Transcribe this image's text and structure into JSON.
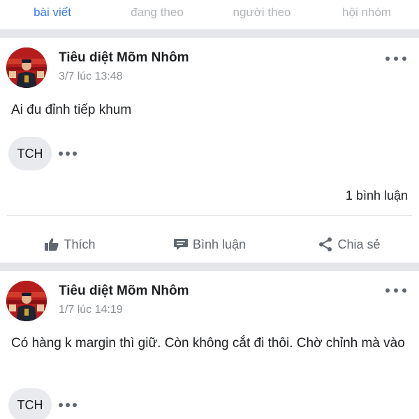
{
  "tabs": [
    {
      "label": "bài viết",
      "active": true
    },
    {
      "label": "đang theo",
      "active": false
    },
    {
      "label": "người theo",
      "active": false
    },
    {
      "label": "hội nhóm",
      "active": false
    }
  ],
  "colors": {
    "accent": "#3578e5",
    "separator": "#e4e6e9",
    "muted_text": "#8a8d91",
    "avatar_bg": "#b51d1d"
  },
  "posts": [
    {
      "author": "Tiêu diệt Mõm Nhôm",
      "time": "3/7 lúc 13:48",
      "content": "Ai đu đỉnh tiếp khum",
      "reaction_chip": "TCH",
      "comment_count": "1 bình luận",
      "actions": {
        "like": "Thích",
        "comment": "Bình luận",
        "share": "Chia sẻ"
      }
    },
    {
      "author": "Tiêu diệt Mõm Nhôm",
      "time": "1/7 lúc 14:19",
      "content": "Có hàng k margin thì giữ. Còn không cắt đi thôi. Chờ chỉnh mà vào",
      "reaction_chip": "TCH"
    }
  ],
  "icons": {
    "like": "thumbs-up-icon",
    "comment": "comment-bubble-icon",
    "share": "share-icon",
    "more": "more-horizontal-icon"
  }
}
